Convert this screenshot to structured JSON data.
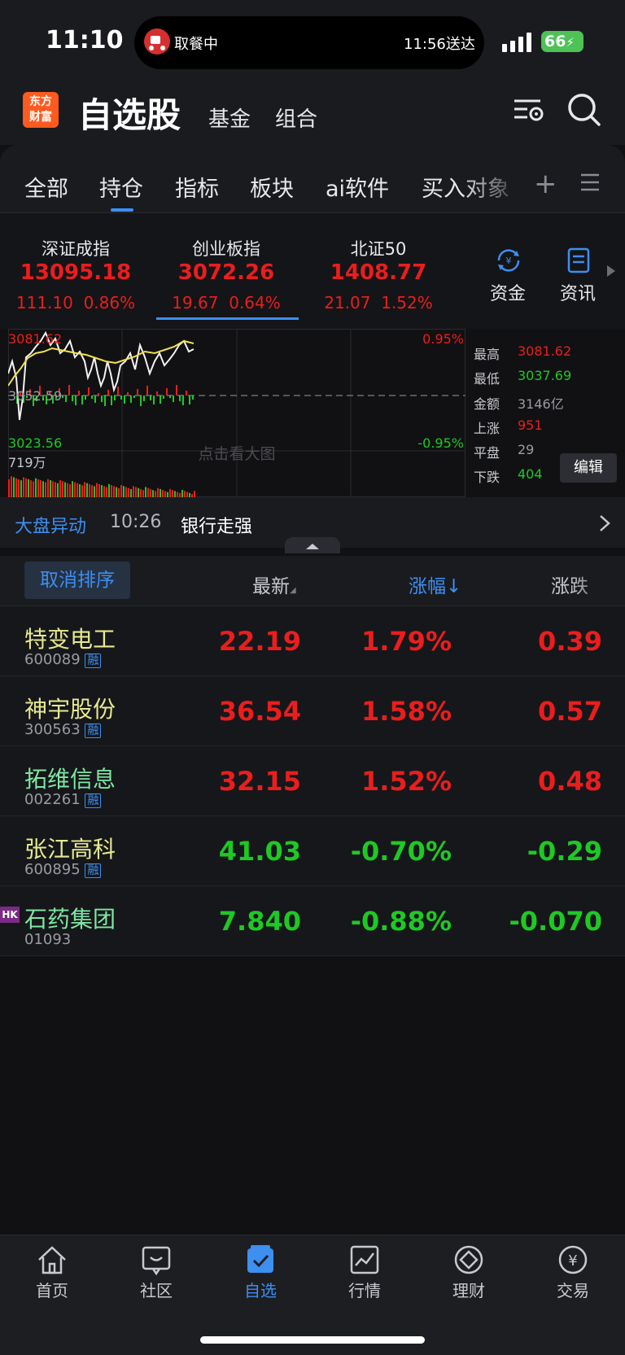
{
  "status_bar": {
    "time": "11:10",
    "island_left": "取餐中",
    "island_right": "11:56送达",
    "battery": "66"
  },
  "header": {
    "logo": [
      "东方",
      "财富"
    ],
    "title": "自选股",
    "nav": [
      "基金",
      "组合"
    ]
  },
  "tabs": [
    "全部",
    "持仓",
    "指标",
    "板块",
    "ai软件",
    "买入对象"
  ],
  "tab_plus": "+",
  "indices": [
    {
      "name": "深证成指",
      "value": "13095.18",
      "change": "111.10",
      "pct": "0.86%"
    },
    {
      "name": "创业板指",
      "value": "3072.26",
      "change": "19.67",
      "pct": "0.64%"
    },
    {
      "name": "北证50",
      "value": "1408.77",
      "change": "21.07",
      "pct": "1.52%"
    }
  ],
  "quick_actions": [
    {
      "label": "资金",
      "icon": "fund-flow-icon"
    },
    {
      "label": "资讯",
      "icon": "news-icon"
    }
  ],
  "chart": {
    "high_label": "3081.62",
    "mid_label": "3052.59",
    "low_label": "3023.56",
    "pct_high": "0.95%",
    "pct_low": "-0.95%",
    "volume_label": "719万",
    "watermark": "点击看大图",
    "stats": [
      {
        "label": "最高",
        "value": "3081.62",
        "color": "red"
      },
      {
        "label": "最低",
        "value": "3037.69",
        "color": "green"
      },
      {
        "label": "金额",
        "value": "3146亿",
        "color": "muted"
      },
      {
        "label": "上涨",
        "value": "951",
        "color": "red"
      },
      {
        "label": "平盘",
        "value": "29",
        "color": "muted"
      },
      {
        "label": "下跌",
        "value": "404",
        "color": "green"
      }
    ],
    "edit": "编辑"
  },
  "alert": {
    "label": "大盘异动",
    "time": "10:26",
    "text": "银行走强"
  },
  "columns": {
    "cancel_sort": "取消排序",
    "latest": "最新",
    "pct": "涨幅",
    "chg": "涨跌"
  },
  "stocks": [
    {
      "name": "特变电工",
      "code": "600089",
      "tag": "融",
      "price": "22.19",
      "pct": "1.79%",
      "chg": "0.39",
      "dir": "up",
      "name_color": "yellow"
    },
    {
      "name": "神宇股份",
      "code": "300563",
      "tag": "融",
      "price": "36.54",
      "pct": "1.58%",
      "chg": "0.57",
      "dir": "up",
      "name_color": "yellow"
    },
    {
      "name": "拓维信息",
      "code": "002261",
      "tag": "融",
      "price": "32.15",
      "pct": "1.52%",
      "chg": "0.48",
      "dir": "up",
      "name_color": "green"
    },
    {
      "name": "张江高科",
      "code": "600895",
      "tag": "融",
      "price": "41.03",
      "pct": "-0.70%",
      "chg": "-0.29",
      "dir": "down",
      "name_color": "yellow"
    },
    {
      "name": "石药集团",
      "code": "01093",
      "tag": "",
      "price": "7.840",
      "pct": "-0.88%",
      "chg": "-0.070",
      "dir": "down",
      "name_color": "green",
      "badge": "HK"
    }
  ],
  "bottom_nav": [
    {
      "label": "首页",
      "icon": "home-icon"
    },
    {
      "label": "社区",
      "icon": "community-icon"
    },
    {
      "label": "自选",
      "icon": "watchlist-icon",
      "active": true
    },
    {
      "label": "行情",
      "icon": "market-icon"
    },
    {
      "label": "理财",
      "icon": "wealth-icon"
    },
    {
      "label": "交易",
      "icon": "trade-icon"
    }
  ]
}
